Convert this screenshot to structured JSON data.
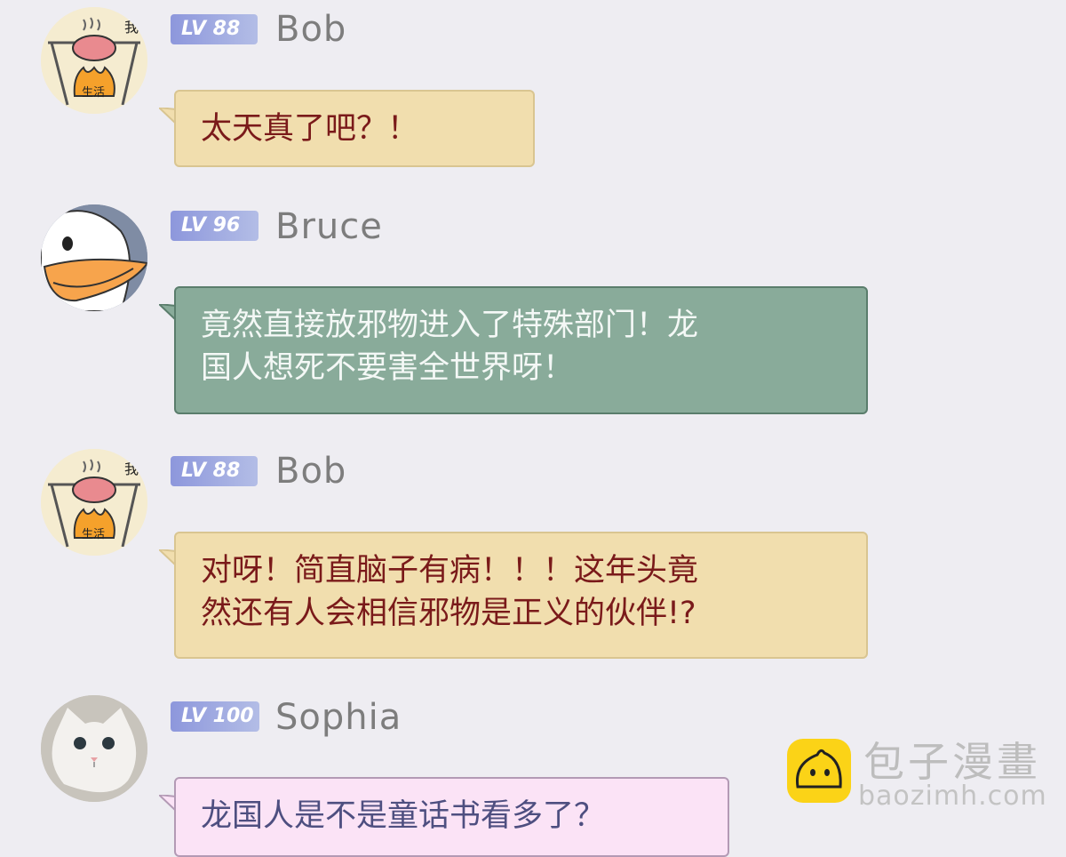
{
  "messages": [
    {
      "level": "LV 88",
      "name": "Bob",
      "text_lines": [
        "太天真了吧？！"
      ]
    },
    {
      "level": "LV 96",
      "name": "Bruce",
      "text_lines": [
        "竟然直接放邪物进入了特殊部门！龙",
        "国人想死不要害全世界呀！"
      ]
    },
    {
      "level": "LV 88",
      "name": "Bob",
      "text_lines": [
        "对呀！简直脑子有病！！！这年头竟",
        "然还有人会相信邪物是正义的伙伴!?"
      ]
    },
    {
      "level": "LV 100",
      "name": "Sophia",
      "text_lines": [
        "龙国人是不是童话书看多了？"
      ]
    }
  ],
  "avatars": {
    "bob": {
      "icon": "roasted-pig-avatar-icon",
      "caption_top": "我",
      "caption_bottom": "生活"
    },
    "bruce": {
      "icon": "cartoon-duck-avatar-icon"
    },
    "sophia": {
      "icon": "white-cat-avatar-icon"
    }
  },
  "watermark": {
    "icon": "steamed-bun-logo-icon",
    "title": "包子漫畫",
    "url": "baozimh.com"
  },
  "colors": {
    "background": "#eeedf2",
    "level_badge": "#8d97dc",
    "bubble_yellow": "#f1deae",
    "bubble_green": "#89ab9a",
    "bubble_pink": "#fbe3f6",
    "text_dark_red": "#7a1a1a"
  }
}
